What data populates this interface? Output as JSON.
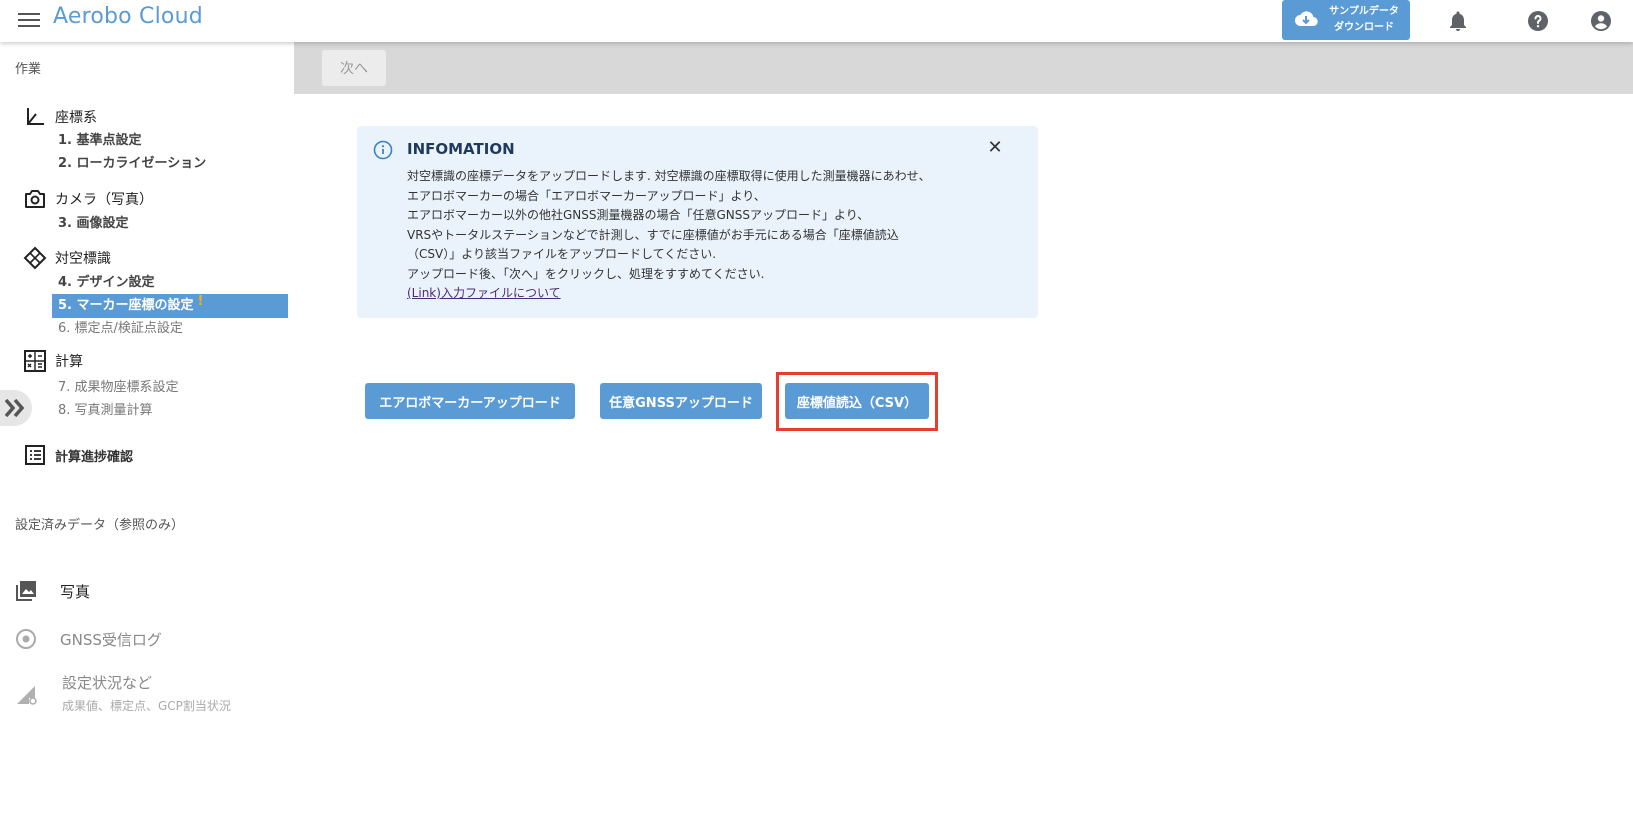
{
  "header": {
    "title": "Aerobo Cloud",
    "sample_line1": "サンプルデータ",
    "sample_line2": "ダウンロード"
  },
  "sidebar": {
    "section_work": "作業",
    "groups": [
      {
        "label": "座標系",
        "icon": "coordinate-axis-icon"
      },
      {
        "label": "カメラ（写真）",
        "icon": "camera-icon"
      },
      {
        "label": "対空標識",
        "icon": "diamond-marker-icon"
      },
      {
        "label": "計算",
        "icon": "calculator-icon"
      }
    ],
    "steps": [
      {
        "num": "1.",
        "label": "基準点設定"
      },
      {
        "num": "2.",
        "label": "ローカライゼーション"
      },
      {
        "num": "3.",
        "label": "画像設定"
      },
      {
        "num": "4.",
        "label": "デザイン設定"
      },
      {
        "num": "5.",
        "label": "マーカー座標の設定",
        "warn": "!"
      },
      {
        "num": "6.",
        "label": "標定点/検証点設定"
      },
      {
        "num": "7.",
        "label": "成果物座標系設定"
      },
      {
        "num": "8.",
        "label": "写真測量計算"
      }
    ],
    "progress_label": "計算進捗確認",
    "section_ref": "設定済みデータ（参照のみ）",
    "photos_label": "写真",
    "gnss_log_label": "GNSS受信ログ",
    "settings_label": "設定状況など",
    "settings_sub": "成果値、標定点、GCP割当状況"
  },
  "toolbar": {
    "next_label": "次へ"
  },
  "info": {
    "title": "INFOMATION",
    "lines": [
      "対空標識の座標データをアップロードします. 対空標識の座標取得に使用した測量機器にあわせ、",
      "エアロボマーカーの場合「エアロボマーカーアップロード」より、",
      "エアロボマーカー以外の他社GNSS測量機器の場合「任意GNSSアップロード」より、",
      "VRSやトータルステーションなどで計測し、すでに座標値がお手元にある場合「座標値読込",
      "（CSV）」より該当ファイルをアップロードしてください.",
      "アップロード後、「次へ」をクリックし、処理をすすめてください."
    ],
    "link": "(Link)入力ファイルについて"
  },
  "actions": {
    "aerobo_upload": "エアロボマーカーアップロード",
    "gnss_upload": "任意GNSSアップロード",
    "csv_import": "座標値読込（CSV）"
  },
  "colors": {
    "accent": "#5b9bd5",
    "highlight": "#e3402b",
    "info_bg": "#eaf3fc",
    "warn": "#f4b400"
  }
}
